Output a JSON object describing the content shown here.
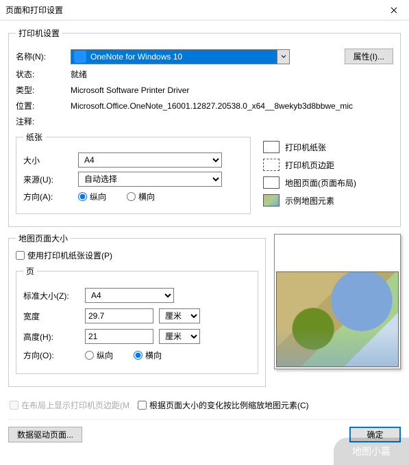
{
  "window": {
    "title": "页面和打印设置"
  },
  "printer": {
    "legend": "打印机设置",
    "name_label": "名称(N):",
    "name_value": "OneNote for Windows 10",
    "properties_btn": "属性(I)...",
    "status_label": "状态:",
    "status_value": "就绪",
    "type_label": "类型:",
    "type_value": "Microsoft Software Printer Driver",
    "location_label": "位置:",
    "location_value": "Microsoft.Office.OneNote_16001.12827.20538.0_x64__8wekyb3d8bbwe_mic",
    "comment_label": "注释:"
  },
  "paper": {
    "legend": "纸张",
    "size_label": "大小",
    "size_value": "A4",
    "source_label": "来源(U):",
    "source_value": "自动选择",
    "orient_label": "方向(A):",
    "orient_portrait": "纵向",
    "orient_landscape": "横向"
  },
  "legend_items": {
    "printer_paper": "打印机纸张",
    "printer_margin": "打印机页边距",
    "map_page": "地图页面(页面布局)",
    "sample_elem": "示例地图元素"
  },
  "mapsize": {
    "legend": "地图页面大小",
    "use_printer": "使用打印机纸张设置(P)",
    "page_legend": "页",
    "std_size_label": "标准大小(Z):",
    "std_size_value": "A4",
    "width_label": "宽度",
    "width_value": "29.7",
    "height_label": "高度(H):",
    "height_value": "21",
    "unit": "厘米",
    "orient_label": "方向(O):",
    "orient_portrait": "纵向",
    "orient_landscape": "横向"
  },
  "bottom": {
    "show_margin": "在布局上显示打印机页边距(M",
    "scale_elems": "根据页面大小的变化按比例缩放地图元素(C)"
  },
  "buttons": {
    "data_driven": "数据驱动页面...",
    "ok": "确定"
  },
  "watermark": "地图小嘉"
}
